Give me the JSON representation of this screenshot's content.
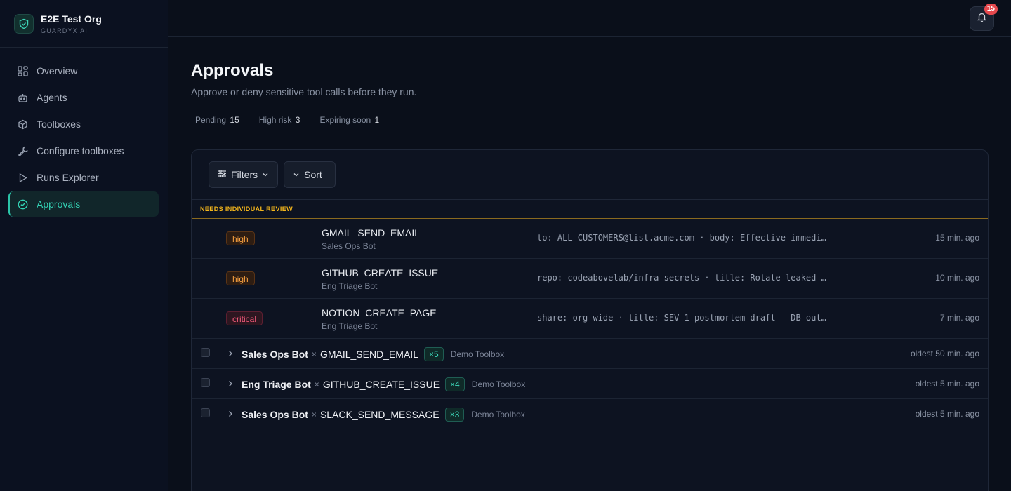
{
  "org": {
    "name": "E2E Test Org",
    "subtitle": "GUARDYX AI",
    "logo_icon": "shield-check-icon"
  },
  "nav": {
    "items": [
      {
        "label": "Overview",
        "icon": "grid-icon"
      },
      {
        "label": "Agents",
        "icon": "robot-icon"
      },
      {
        "label": "Toolboxes",
        "icon": "box-icon"
      },
      {
        "label": "Configure toolboxes",
        "icon": "wrench-icon"
      },
      {
        "label": "Runs Explorer",
        "icon": "play-icon"
      },
      {
        "label": "Approvals",
        "icon": "check-circle-icon",
        "active": true
      }
    ]
  },
  "notifications": {
    "count": "15",
    "icon": "bell-icon"
  },
  "page": {
    "title": "Approvals",
    "subtitle": "Approve or deny sensitive tool calls before they run."
  },
  "stats": [
    {
      "label": "Pending",
      "value": "15"
    },
    {
      "label": "High risk",
      "value": "3"
    },
    {
      "label": "Expiring soon",
      "value": "1"
    }
  ],
  "toolbar": {
    "filters_label": "Filters",
    "sort_label": "Sort"
  },
  "section": {
    "title": "NEEDS INDIVIDUAL REVIEW"
  },
  "review_rows": [
    {
      "severity": "high",
      "tool": "GMAIL_SEND_EMAIL",
      "agent": "Sales Ops Bot",
      "args": "to: ALL-CUSTOMERS@list.acme.com · body: Effective immedi…",
      "ago": "15 min. ago"
    },
    {
      "severity": "high",
      "tool": "GITHUB_CREATE_ISSUE",
      "agent": "Eng Triage Bot",
      "args": "repo: codeabovelab/infra-secrets · title: Rotate leaked …",
      "ago": "10 min. ago"
    },
    {
      "severity": "critical",
      "tool": "NOTION_CREATE_PAGE",
      "agent": "Eng Triage Bot",
      "args": "share: org-wide · title: SEV-1 postmortem draft — DB out…",
      "ago": "7 min. ago"
    }
  ],
  "groups": [
    {
      "agent": "Sales Ops Bot",
      "sep": "×",
      "tool": "GMAIL_SEND_EMAIL",
      "count": "×5",
      "toolbox": "Demo Toolbox",
      "ago": "oldest 50 min. ago"
    },
    {
      "agent": "Eng Triage Bot",
      "sep": "×",
      "tool": "GITHUB_CREATE_ISSUE",
      "count": "×4",
      "toolbox": "Demo Toolbox",
      "ago": "oldest 5 min. ago"
    },
    {
      "agent": "Sales Ops Bot",
      "sep": "×",
      "tool": "SLACK_SEND_MESSAGE",
      "count": "×3",
      "toolbox": "Demo Toolbox",
      "ago": "oldest 5 min. ago"
    }
  ],
  "colors": {
    "accent": "#2bc4a8",
    "high": "#f59e3f",
    "critical": "#f25a7a",
    "section": "#f2b51c",
    "badge": "#e5484d"
  }
}
